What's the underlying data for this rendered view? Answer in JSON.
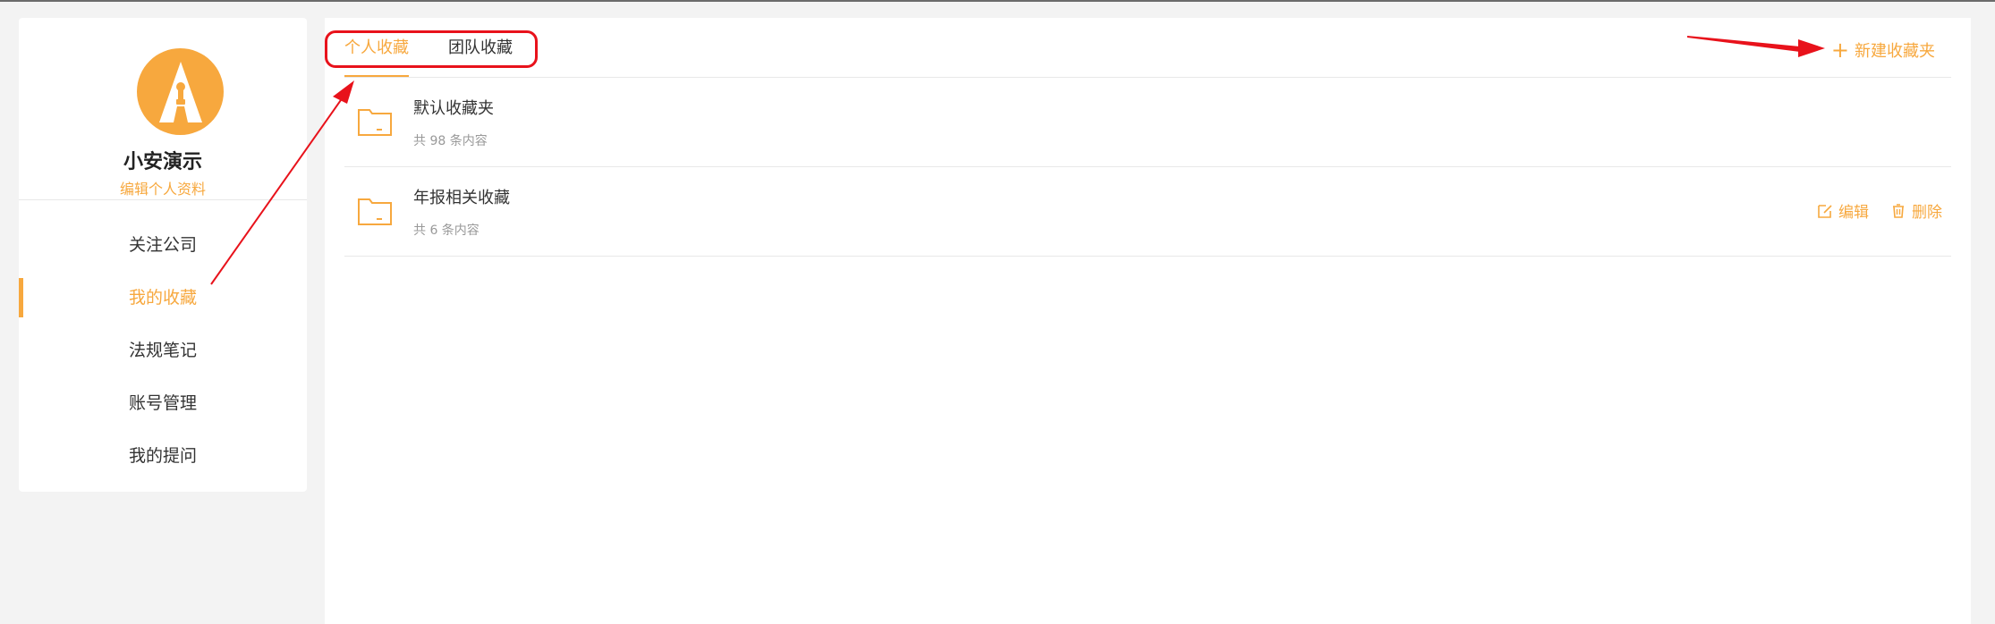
{
  "profile": {
    "name": "小安演示",
    "edit_link": "编辑个人资料",
    "avatar_icon": "tower-logo-icon"
  },
  "sidebar": {
    "items": [
      {
        "label": "关注公司",
        "active": false
      },
      {
        "label": "我的收藏",
        "active": true
      },
      {
        "label": "法规笔记",
        "active": false
      },
      {
        "label": "账号管理",
        "active": false
      },
      {
        "label": "我的提问",
        "active": false
      }
    ]
  },
  "tabs": [
    {
      "label": "个人收藏",
      "active": true
    },
    {
      "label": "团队收藏",
      "active": false
    }
  ],
  "toolbar": {
    "new_folder_label": "新建收藏夹",
    "new_folder_icon": "plus-icon"
  },
  "folders": [
    {
      "name": "默认收藏夹",
      "count": "共 98 条内容",
      "show_actions": false
    },
    {
      "name": "年报相关收藏",
      "count": "共 6 条内容",
      "show_actions": true
    }
  ],
  "row_actions": {
    "edit_label": "编辑",
    "delete_label": "删除"
  },
  "colors": {
    "accent": "#f7a83e",
    "annotation": "#e8121b"
  }
}
